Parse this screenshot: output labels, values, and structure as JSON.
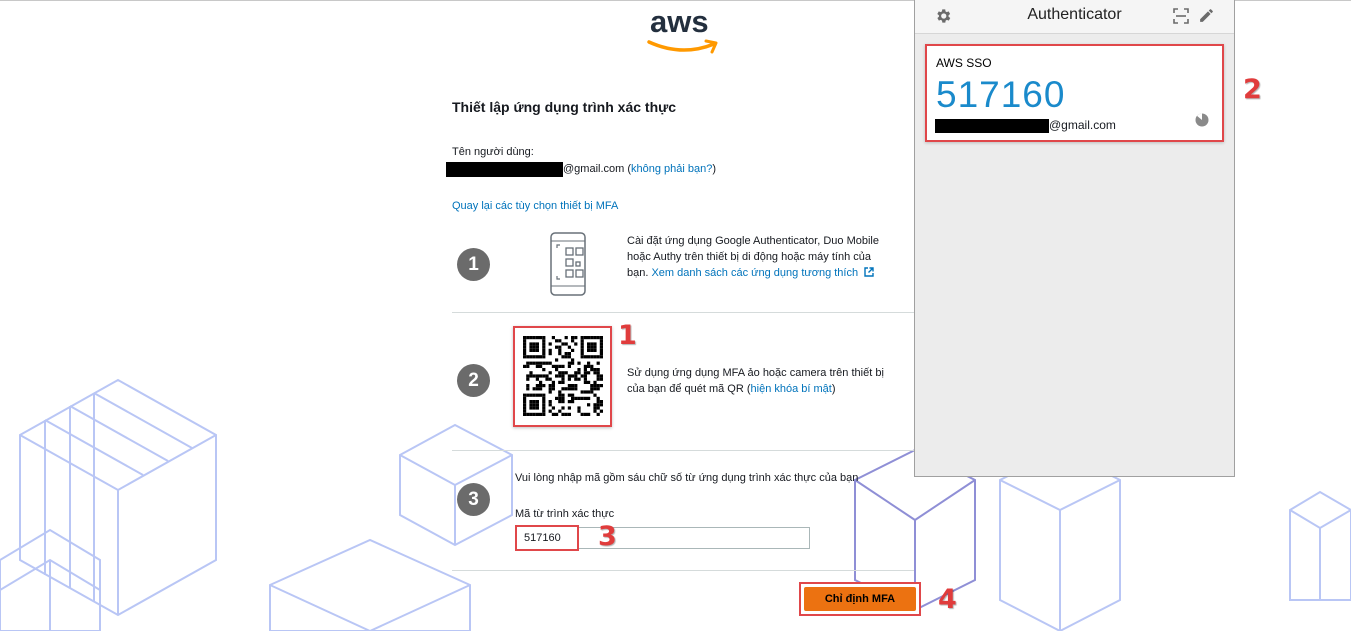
{
  "logo": {
    "text": "aws"
  },
  "page": {
    "title": "Thiết lập ứng dụng trình xác thực",
    "user_label": "Tên người dùng:",
    "user_email_suffix": "@gmail.com",
    "paren_open": " (",
    "not_you_link": "không phải bạn?",
    "paren_close": ")",
    "back_link": "Quay lại các tùy chọn thiết bị MFA"
  },
  "steps": [
    {
      "number": "1",
      "text": "Cài đặt ứng dụng Google Authenticator, Duo Mobile hoặc Authy trên thiết bị di động hoặc máy tính của",
      "text2": "bạn. ",
      "link": "Xem danh sách các ứng dụng tương thích",
      "icon": "phone-qr-icon"
    },
    {
      "number": "2",
      "text": "Sử dụng ứng dụng MFA ảo hoặc camera trên thiết bị của bạn để quét mã QR (",
      "link": "hiện khóa bí mật",
      "text_end": ")",
      "icon": "qr-code-icon"
    },
    {
      "number": "3",
      "text": "Vui lòng nhập mã gồm sáu chữ số từ ứng dụng trình xác thực của bạn",
      "field_label": "Mã từ trình xác thực",
      "field_value": "517160"
    }
  ],
  "assign_button": "Chỉ định MFA",
  "annotations": [
    "1",
    "2",
    "3",
    "4"
  ],
  "authenticator": {
    "title": "Authenticator",
    "issuer": "AWS SSO",
    "code": "517160",
    "account_suffix": "@gmail.com",
    "icons": [
      "gear-icon",
      "scan-qr-icon",
      "pencil-icon",
      "timer-icon"
    ]
  },
  "colors": {
    "accent_link": "#0073bb",
    "button": "#ec7211",
    "code": "#1a8acb",
    "annotation": "#e0474a"
  }
}
